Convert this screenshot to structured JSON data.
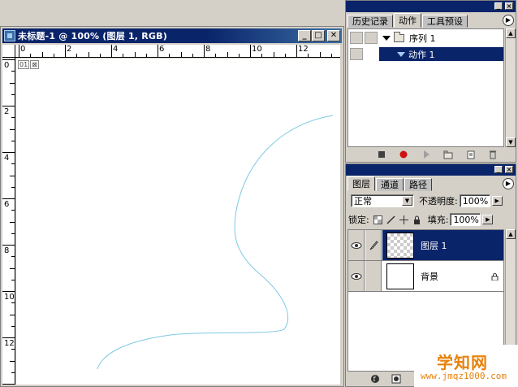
{
  "document": {
    "title": "未标题-1 @ 100% (图层 1, RGB)",
    "hruler_numbers": [
      "0",
      "2",
      "4",
      "6",
      "8",
      "10",
      "12"
    ],
    "vruler_numbers": [
      "0",
      "2",
      "4",
      "6",
      "8",
      "10",
      "12"
    ],
    "badge_slice": "01",
    "path_color": "#7ec8e3"
  },
  "actions_panel": {
    "tabs": [
      "历史记录",
      "动作",
      "工具预设"
    ],
    "active_tab": "动作",
    "items": [
      {
        "label": "序列 1",
        "type": "set",
        "selected": false
      },
      {
        "label": "动作 1",
        "type": "action",
        "selected": true
      }
    ],
    "toolbar_icons": [
      "stop-icon",
      "record-icon",
      "play-icon",
      "new-set-icon",
      "new-action-icon",
      "delete-icon"
    ]
  },
  "layers_panel": {
    "tabs": [
      "图层",
      "通道",
      "路径"
    ],
    "active_tab": "图层",
    "blend_mode": "正常",
    "opacity_label": "不透明度:",
    "opacity_value": "100%",
    "lock_label": "锁定:",
    "fill_label": "填充:",
    "fill_value": "100%",
    "layers": [
      {
        "name": "图层 1",
        "selected": true,
        "thumbnail": "transparent"
      },
      {
        "name": "背景",
        "selected": false,
        "thumbnail": "white",
        "locked": true
      }
    ]
  },
  "watermark": {
    "title": "学知网",
    "url": "www.jmqz1000.com"
  },
  "colors": {
    "titlebar": "#0a246a",
    "selection": "#0a246a",
    "face": "#d4d0c8",
    "watermark": "#e8820c"
  }
}
